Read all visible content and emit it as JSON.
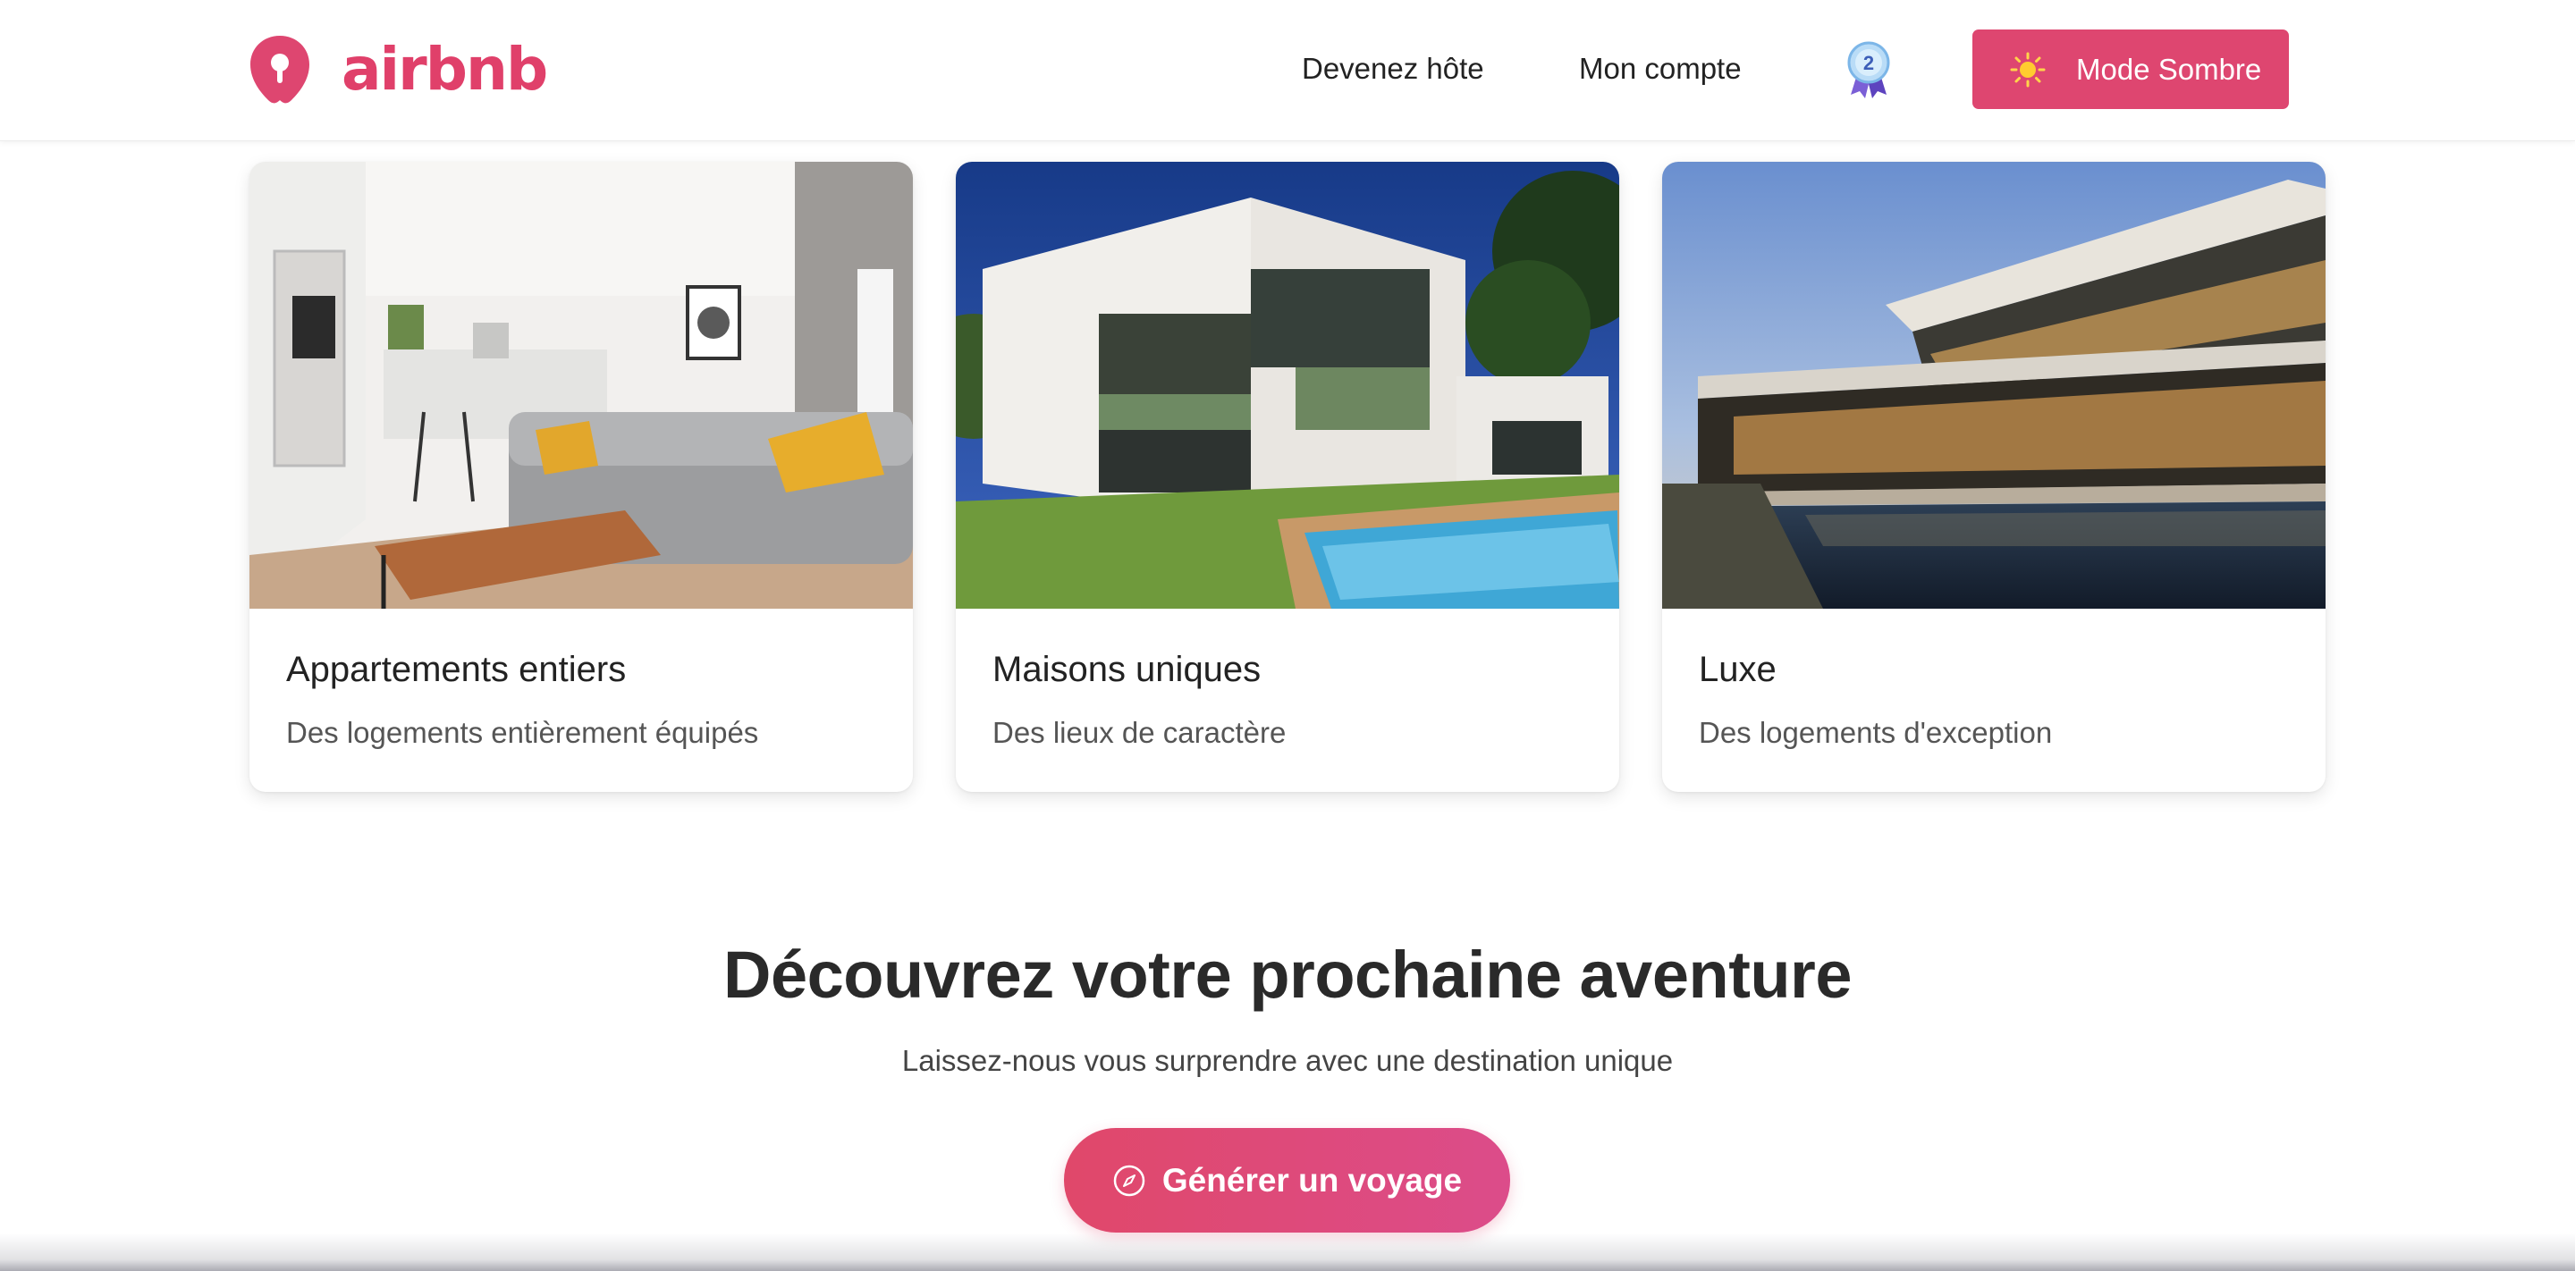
{
  "header": {
    "logo_text": "airbnb",
    "nav": {
      "host_label": "Devenez hôte",
      "account_label": "Mon compte"
    },
    "badge_number": "2",
    "mode_button_label": "Mode Sombre"
  },
  "cards": [
    {
      "title": "Appartements entiers",
      "subtitle": "Des logements entièrement équipés"
    },
    {
      "title": "Maisons uniques",
      "subtitle": "Des lieux de caractère"
    },
    {
      "title": "Luxe",
      "subtitle": "Des logements d'exception"
    }
  ],
  "cta": {
    "title": "Découvrez votre prochaine aventure",
    "subtitle": "Laissez-nous vous surprendre avec une destination unique",
    "button_label": "Générer un voyage"
  },
  "colors": {
    "brand": "#de4670",
    "text": "#222222",
    "muted": "#555555"
  }
}
